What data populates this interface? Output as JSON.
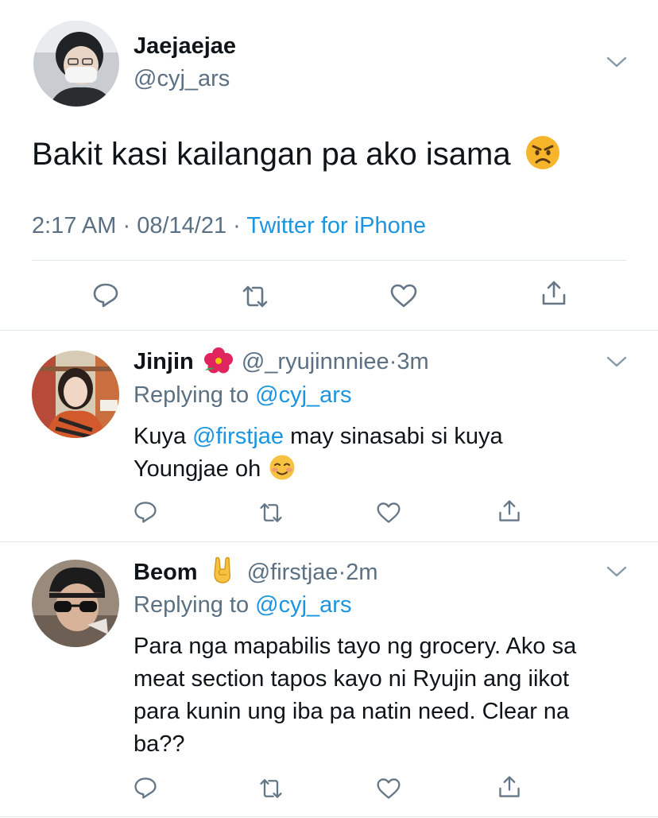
{
  "main_tweet": {
    "display_name": "Jaejaejae",
    "handle": "@cyj_ars",
    "text": "Bakit kasi kailangan pa ako isama",
    "emoji": "angry-face",
    "time": "2:17 AM",
    "dot": "·",
    "date": "08/14/21",
    "dot2": "·",
    "source": "Twitter for iPhone"
  },
  "replies": [
    {
      "display_name": "Jinjin",
      "name_emoji": "hibiscus",
      "handle": "@_ryujinnniee",
      "dot": "·",
      "age": "3m",
      "replying_label": "Replying to",
      "replying_handle": "@cyj_ars",
      "text_prefix": "Kuya",
      "mention": "@firstjae",
      "text_line1_rest": "may sinasabi si kuya",
      "text_line2": "Youngjae oh",
      "text_emoji": "smiling-face"
    },
    {
      "display_name": "Beom",
      "name_emoji": "sign-of-the-horns",
      "handle": "@firstjae",
      "dot": "·",
      "age": "2m",
      "replying_label": "Replying to",
      "replying_handle": "@cyj_ars",
      "lines": [
        "Para nga mapabilis tayo ng grocery. Ako sa",
        "meat section tapos kayo ni Ryujin ang iikot",
        "para kunin ung iba pa natin need. Clear na",
        "ba??"
      ]
    }
  ],
  "colors": {
    "text": "#0f1419",
    "secondary": "#5b7083",
    "link": "#1b95e0",
    "divider": "#e1e8ed"
  },
  "icons": [
    "reply-icon",
    "retweet-icon",
    "like-icon",
    "share-icon",
    "chevron-down-icon"
  ]
}
